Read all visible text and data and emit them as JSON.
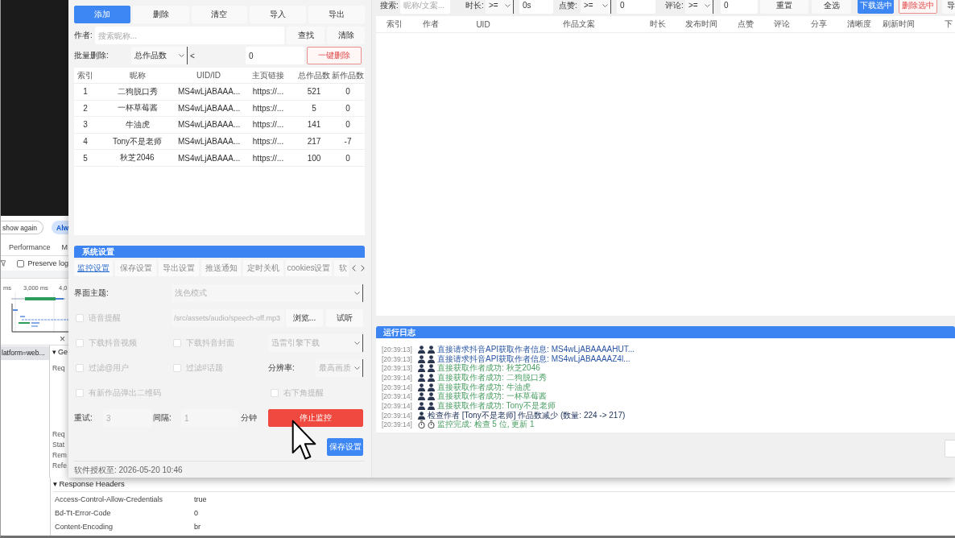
{
  "devtools": {
    "banner_buttons": [
      {
        "label": "show again",
        "kind": "outline"
      },
      {
        "label": "Alw",
        "kind": "filled"
      }
    ],
    "tabs": [
      "Performance",
      "M"
    ],
    "preserve_log": {
      "label": "Preserve log",
      "checked": false
    },
    "timeline_ticks": [
      "ms",
      "3,000 ms",
      "4,0"
    ],
    "close": "×",
    "request": {
      "name": "latform=web...",
      "selected": true
    },
    "general": {
      "title": "▾ Ge",
      "rows": [
        "Req",
        "Req",
        "Stat",
        "Rem",
        "Refe"
      ]
    },
    "response_headers": {
      "title": "▾ Response Headers",
      "rows": [
        {
          "name": "Access-Control-Allow-Credentials",
          "value": "true"
        },
        {
          "name": "Bd-Tt-Error-Code",
          "value": "0"
        },
        {
          "name": "Content-Encoding",
          "value": "br"
        }
      ]
    }
  },
  "author_panel": {
    "toolbar": [
      {
        "label": "添加",
        "kind": "primary"
      },
      {
        "label": "删除",
        "kind": "default"
      },
      {
        "label": "清空",
        "kind": "default"
      },
      {
        "label": "导入",
        "kind": "default"
      },
      {
        "label": "导出",
        "kind": "default"
      }
    ],
    "search": {
      "label": "作者:",
      "placeholder": "搜索昵称...",
      "buttons": [
        "查找",
        "清除"
      ]
    },
    "batch_delete": {
      "label": "批量删除:",
      "field": "总作品数",
      "operator": "<",
      "value": "0",
      "button": "一键删除"
    },
    "table": {
      "columns": [
        "索引",
        "昵称",
        "UID/ID",
        "主页链接",
        "总作品数",
        "新作品数"
      ],
      "rows": [
        [
          "1",
          "二狗脱口秀",
          "MS4wLjABAAA...",
          "https://...",
          "521",
          "0"
        ],
        [
          "2",
          "一杯草莓酱",
          "MS4wLjABAAA...",
          "https://...",
          "5",
          "0"
        ],
        [
          "3",
          "牛油虎",
          "MS4wLjABAAA...",
          "https://...",
          "141",
          "0"
        ],
        [
          "4",
          "Tony不是老师",
          "MS4wLjABAAA...",
          "https://...",
          "217",
          "-7"
        ],
        [
          "5",
          "秋芝2046",
          "MS4wLjABAAA...",
          "https://...",
          "100",
          "0"
        ]
      ]
    }
  },
  "settings": {
    "title": "系统设置",
    "tabs": [
      {
        "label": "监控设置",
        "selected": true
      },
      {
        "label": "保存设置",
        "selected": false
      },
      {
        "label": "导出设置",
        "selected": false
      },
      {
        "label": "推送通知",
        "selected": false
      },
      {
        "label": "定时关机",
        "selected": false
      },
      {
        "label": "cookies设置",
        "selected": false
      },
      {
        "label": "软",
        "selected": false
      }
    ],
    "theme": {
      "label": "界面主题:",
      "value": "浅色模式",
      "disabled": true
    },
    "voice": {
      "checkbox": {
        "label": "语音提醒",
        "checked": false,
        "disabled": true
      },
      "path": {
        "value": "/src/assets/audio/speech-off.mp3",
        "disabled": true
      },
      "buttons": [
        "浏览...",
        "试听"
      ]
    },
    "download": {
      "video": {
        "label": "下载抖音视频",
        "checked": false,
        "disabled": true
      },
      "cover": {
        "label": "下载抖音封面",
        "checked": false,
        "disabled": true
      },
      "engine": {
        "value": "迅雷引擎下载",
        "disabled": true
      }
    },
    "filter": {
      "user": {
        "label": "过滤@用户",
        "checked": false,
        "disabled": true
      },
      "topic": {
        "label": "过滤#话题",
        "checked": false,
        "disabled": true
      },
      "resolution": {
        "label": "分辨率:",
        "value": "最高画质",
        "disabled": true
      }
    },
    "notify": {
      "qr_code": {
        "label": "有新作品弹出二维码",
        "checked": false,
        "disabled": true
      },
      "corner": {
        "label": "右下角提醒",
        "checked": false,
        "disabled": true
      }
    },
    "retry": {
      "label": "重试:",
      "value": "3",
      "disabled": true
    },
    "interval": {
      "label": "间隔:",
      "value": "1",
      "unit": "分钟",
      "disabled": true
    },
    "stop_button": "停止监控",
    "save_button": "保存设置",
    "license": "软件授权至: 2026-05-20 10:46"
  },
  "works_panel": {
    "filters": [
      {
        "label": "搜索:",
        "placeholder": "昵称/文案..."
      },
      {
        "label": "时长:",
        "operator": ">=",
        "value": "0s"
      },
      {
        "label": "点赞:",
        "operator": ">=",
        "value": "0"
      },
      {
        "label": "评论:",
        "operator": ">=",
        "value": "0"
      }
    ],
    "buttons": [
      {
        "label": "重置",
        "kind": "default"
      },
      {
        "label": "全选",
        "kind": "default"
      },
      {
        "label": "下载选中",
        "kind": "primary"
      },
      {
        "label": "删除选中",
        "kind": "danger"
      },
      {
        "label": "导",
        "kind": "default"
      }
    ],
    "table": {
      "columns": [
        "索引",
        "作者",
        "UID",
        "作品文案",
        "时长",
        "发布时间",
        "点赞",
        "评论",
        "分享",
        "清晰度",
        "刷新时间",
        "下"
      ]
    }
  },
  "log": {
    "title": "运行日志",
    "lines": [
      {
        "time": "[20:39:13]",
        "kind": "request",
        "text": "直接请求抖音API获取作者信息: MS4wLjABAAAAHUT..."
      },
      {
        "time": "[20:39:13]",
        "kind": "request",
        "text": "直接请求抖音API获取作者信息: MS4wLjABAAAAZ4l..."
      },
      {
        "time": "[20:39:13]",
        "kind": "success",
        "text": "直接获取作者成功: 秋芝2046"
      },
      {
        "time": "[20:39:14]",
        "kind": "success",
        "text": "直接获取作者成功: 二狗脱口秀"
      },
      {
        "time": "[20:39:14]",
        "kind": "success",
        "text": "直接获取作者成功: 牛油虎"
      },
      {
        "time": "[20:39:14]",
        "kind": "success",
        "text": "直接获取作者成功: 一杯草莓酱"
      },
      {
        "time": "[20:39:14]",
        "kind": "success",
        "text": "直接获取作者成功: Tony不是老师"
      },
      {
        "time": "[20:39:14]",
        "kind": "check",
        "text": "检查作者 [Tony不是老师] 作品数减少 (数量: 224 -> 217)"
      },
      {
        "time": "[20:39:14]",
        "kind": "done",
        "text": "监控完成: 检查 5 位, 更新 1"
      }
    ]
  }
}
